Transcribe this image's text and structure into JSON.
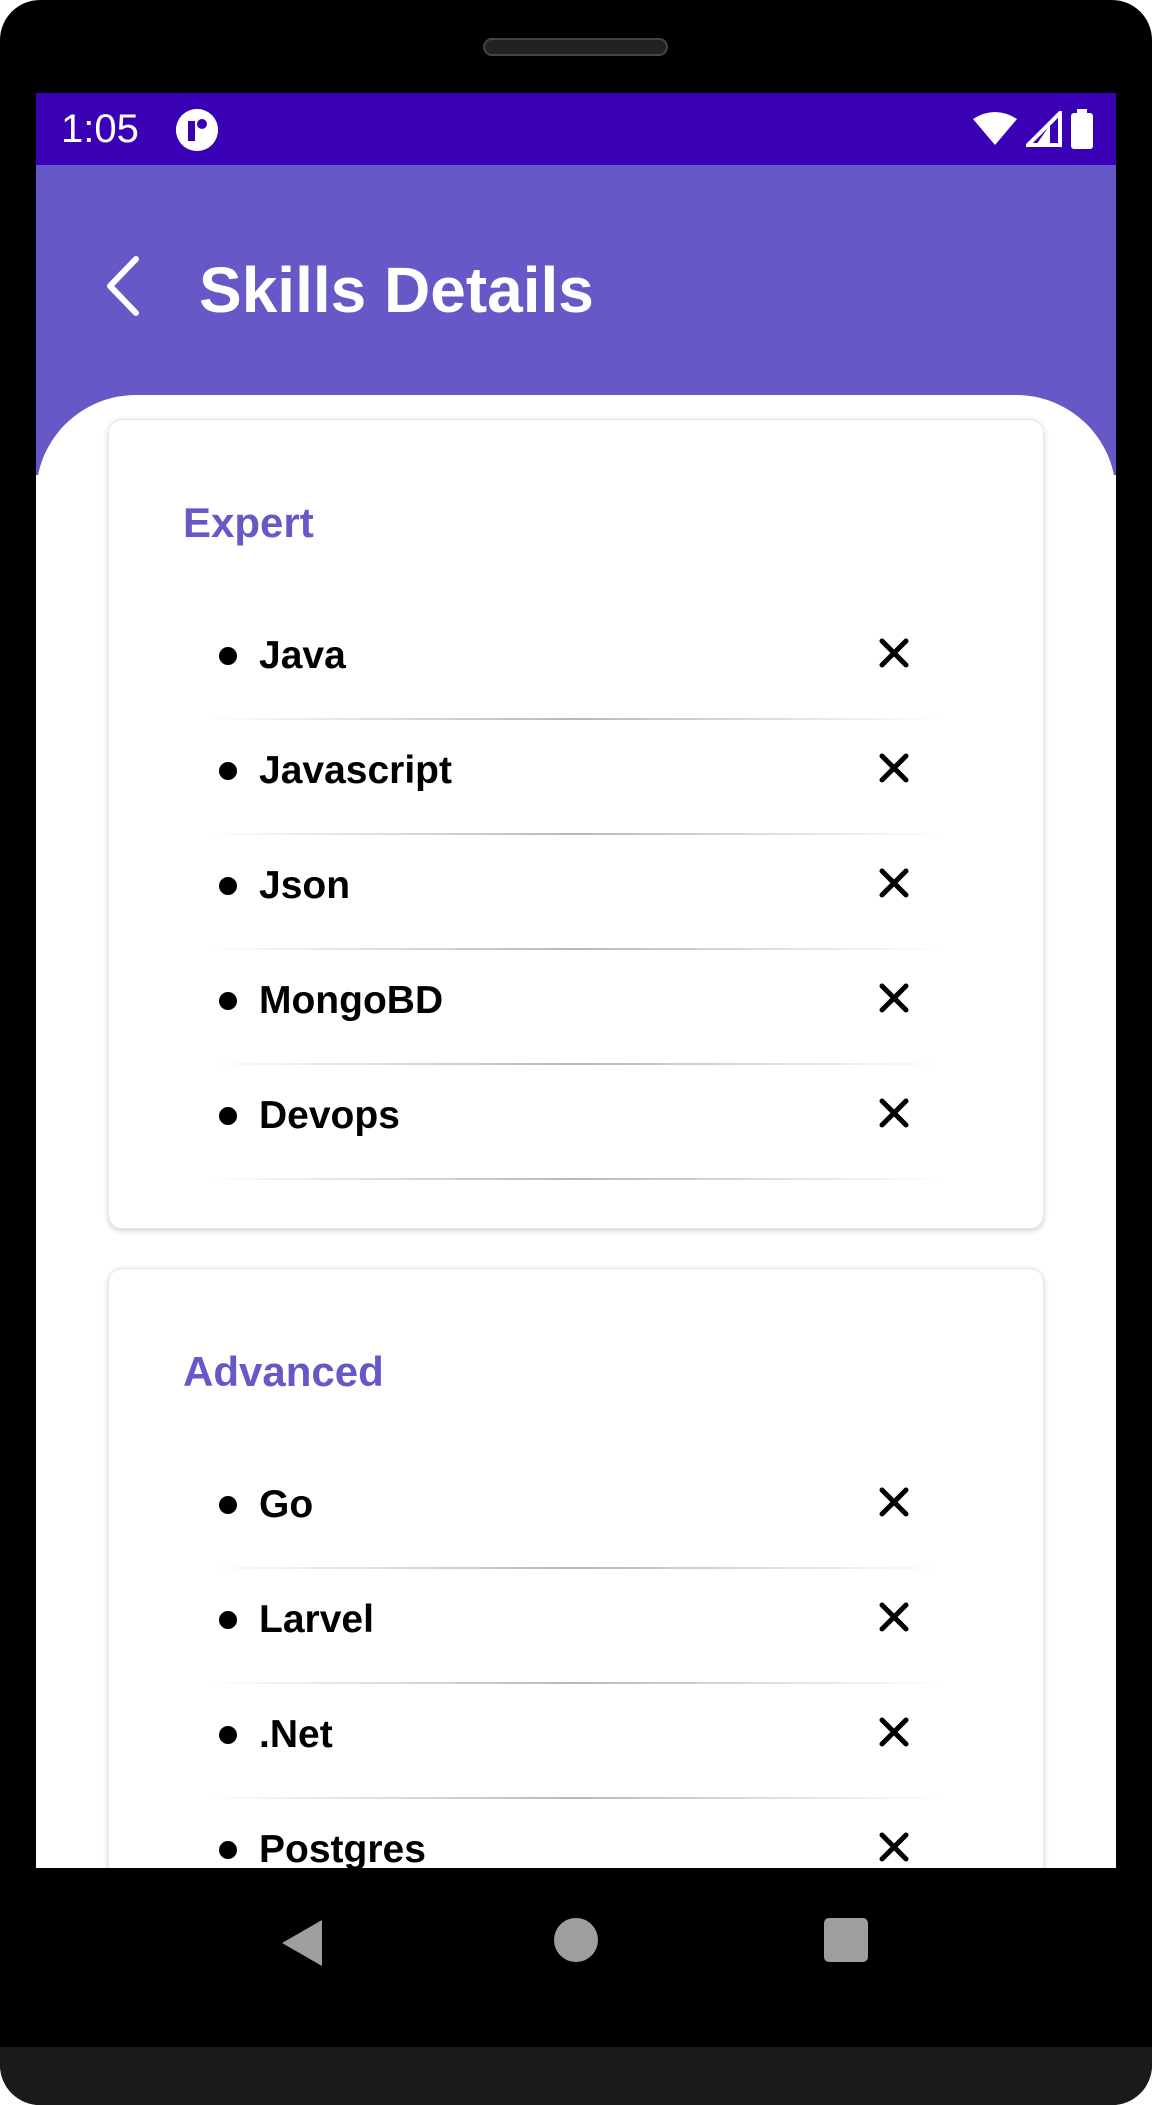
{
  "status_bar": {
    "time": "1:05",
    "app_icon": "circle-app-icon",
    "icons": [
      "wifi-icon",
      "signal-icon",
      "battery-icon"
    ],
    "color": "#3a00b5"
  },
  "header": {
    "title": "Skills Details",
    "back_icon": "chevron-left-icon",
    "color": "#6559c7"
  },
  "sections": [
    {
      "title": "Expert",
      "items": [
        {
          "label": "Java"
        },
        {
          "label": "Javascript"
        },
        {
          "label": "Json"
        },
        {
          "label": "MongoBD"
        },
        {
          "label": "Devops"
        }
      ]
    },
    {
      "title": "Advanced",
      "items": [
        {
          "label": "Go"
        },
        {
          "label": "Larvel"
        },
        {
          "label": ".Net"
        },
        {
          "label": "Postgres"
        }
      ]
    }
  ],
  "item_remove_icon": "close-icon",
  "nav": {
    "icons": [
      "back-triangle-icon",
      "home-circle-icon",
      "recents-square-icon"
    ]
  }
}
